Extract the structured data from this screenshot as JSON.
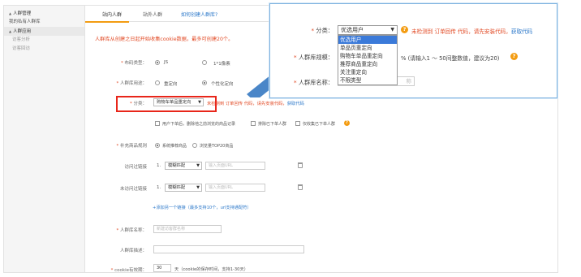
{
  "sidebar": {
    "items": [
      {
        "label": "人群管理",
        "type": "group"
      },
      {
        "label": "我的私有人群库",
        "type": "item"
      },
      {
        "label": "人群应用",
        "type": "group"
      },
      {
        "label": "访客分析",
        "type": "sub"
      },
      {
        "label": "访客回访",
        "type": "sub"
      }
    ]
  },
  "tabs": {
    "items": [
      "站内人群",
      "站外人群"
    ],
    "link": "如何创建人群库?"
  },
  "form": {
    "notice": "人群库从创建之日起开始收集cookie数据，最多可创建20个。",
    "layout_label": "布码类型：",
    "layout_options": [
      "JS",
      "1*1像素"
    ],
    "usage_label": "人群库用途：",
    "usage_options": [
      "重定向",
      "个性化定向"
    ],
    "category_label": "分类：",
    "category_value": "购物车单品重定向",
    "category_note": "未检测到 订单回传 代码，请先安装代码，",
    "category_link": "获取代码",
    "checkbox_options": [
      "用户下单后，删除他之前浏览的商品记录",
      "排除已下单人群",
      "仅收集已下单人群"
    ],
    "supplement_label": "补充商品规则",
    "supplement_options": [
      "系统推荐商品",
      "浏览量TOP20商品"
    ],
    "visit_link_label": "访问过链接",
    "no_visit_link_label": "未访问过链接",
    "match_value": "模糊匹配",
    "url_placeholder": "输入页面URL",
    "row_number": "1.",
    "add_link": "+添加另一个链接（最多支持10个，url支持通配符）",
    "name_label": "人群库名称：",
    "name_placeholder": "新建访客群名称",
    "desc_label": "人群库描述：",
    "cookie_label": "cookie有效期：",
    "cookie_value": "30",
    "cookie_note": "天（cookie的保存时间，支持1-30天）"
  },
  "zoom": {
    "category_label": "分类：",
    "category_value": "优选用户",
    "note": "未检测到 订单回传 代码，请先安装代码，",
    "link": "获取代码",
    "options": [
      "优选用户",
      "单品页重定向",
      "购物车单品重定向",
      "推荐商品重定向",
      "关注重定向",
      "不限类型"
    ],
    "scale_label": "人群库规模：",
    "scale_note": "% (请输入1 ～ 50间整数值，建议为20)",
    "name_label": "人群库名称：",
    "name_placeholder": "称"
  },
  "colors": {
    "accent": "#f39c12",
    "alert": "#e24b26",
    "highlight": "#e8261a",
    "link": "#2a77c9",
    "arrow": "#4a86c8"
  }
}
